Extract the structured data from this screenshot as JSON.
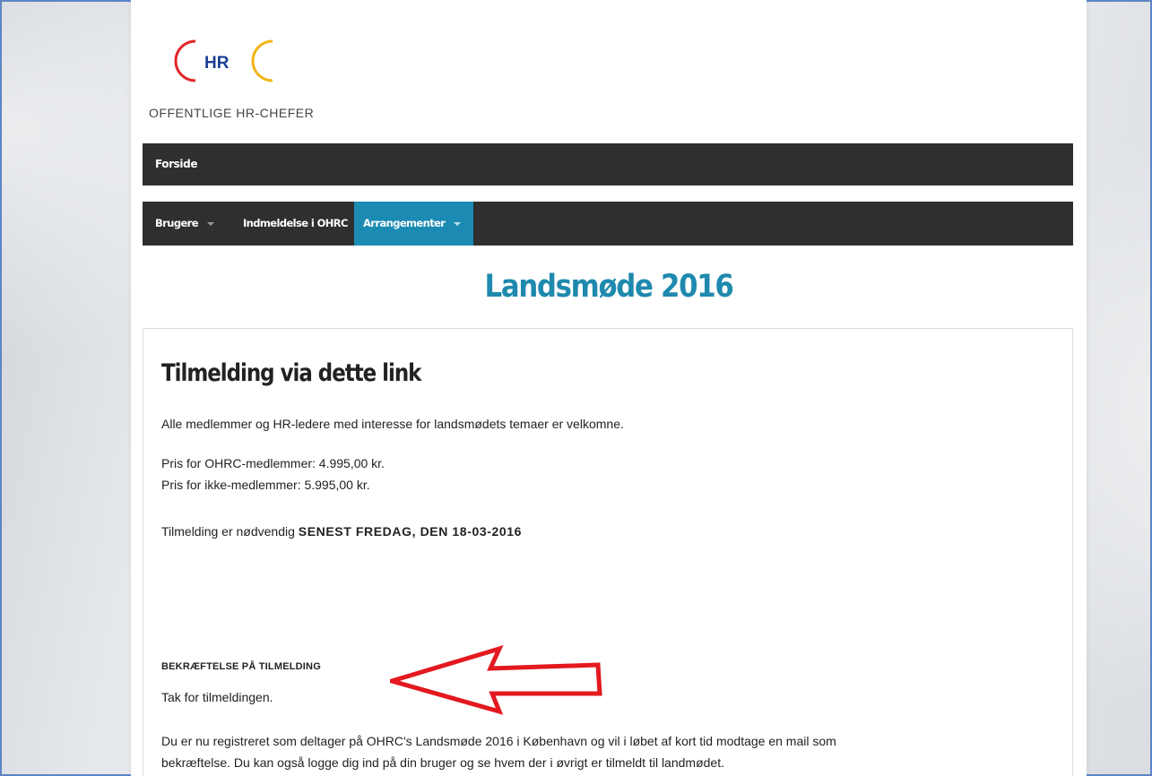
{
  "logo": {
    "monogram": "HR",
    "caption": "OFFENTLIGE HR-CHEFER"
  },
  "nav_top": {
    "items": [
      {
        "label": "Forside"
      }
    ]
  },
  "nav_main": {
    "items": [
      {
        "label": "Brugere",
        "has_dropdown": true,
        "active": false
      },
      {
        "label": "Indmeldelse i OHRC",
        "has_dropdown": false,
        "active": false
      },
      {
        "label": "Arrangementer",
        "has_dropdown": true,
        "active": true
      }
    ]
  },
  "page_title": "Landsmøde 2016",
  "content": {
    "heading": "Tilmelding via dette link",
    "intro": "Alle medlemmer og HR-ledere med interesse for landsmødets temaer er velkomne.",
    "price_members": "Pris for OHRC-medlemmer: 4.995,00 kr.",
    "price_nonmembers": "Pris for ikke-medlemmer: 5.995,00 kr.",
    "deadline_prefix": "Tilmelding er nødvendig ",
    "deadline_bold": "SENEST FREDAG, DEN 18-03-2016",
    "confirmation_heading": "BEKRÆFTELSE PÅ TILMELDING",
    "thanks": "Tak for tilmeldingen.",
    "body_line1": "Du er nu registreret som deltager på OHRC's Landsmøde 2016 i København og vil i løbet af kort tid modtage en mail som",
    "body_line2": "bekræftelse. Du kan også logge dig ind på din bruger og se hvem der i øvrigt er tilmeldt til landmødet."
  },
  "colors": {
    "accent": "#1f89ae",
    "nav_bg": "#2f2f2f",
    "nav_active": "#1b8bb4",
    "logo_red": "#e0262c",
    "logo_yellow": "#f2b51a",
    "logo_blue": "#1c3f94",
    "arrow_red": "#e3191f",
    "frame_border": "#5b86c5"
  }
}
